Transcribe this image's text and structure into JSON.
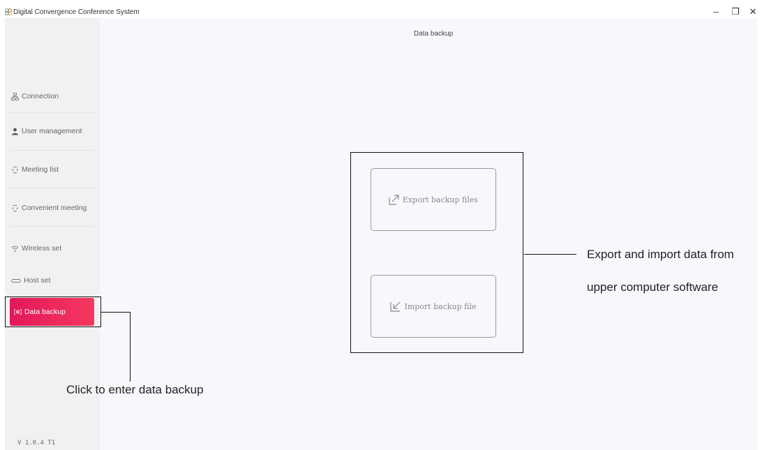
{
  "window": {
    "title": "Digital Convergence Conference System",
    "controls": {
      "minimize": "–",
      "maximize": "❐",
      "close": "✕"
    }
  },
  "sidebar": {
    "items": [
      {
        "label": "Connection",
        "icon": "network-icon"
      },
      {
        "label": "User management",
        "icon": "user-icon"
      },
      {
        "label": "Meeting list",
        "icon": "meeting-icon"
      },
      {
        "label": "Convenient meeting",
        "icon": "meeting-icon"
      },
      {
        "label": "Wireless set",
        "icon": "wifi-icon"
      },
      {
        "label": "Host set",
        "icon": "host-icon"
      }
    ],
    "active_item": {
      "label": "Data backup",
      "icon": "backup-icon"
    },
    "version": "V 1.0.4 T1"
  },
  "main": {
    "page_title": "Data backup",
    "export_button": {
      "label": "Export backup files",
      "icon": "export-icon"
    },
    "import_button": {
      "label": "Import backup file",
      "icon": "import-icon"
    }
  },
  "annotations": {
    "right_line1": "Export and import data from",
    "right_line2": "upper computer software",
    "bottom": "Click to enter data backup"
  },
  "colors": {
    "accent": "#e91e5a",
    "sidebar_bg": "#f1f1f1",
    "main_bg": "#f7f8fb"
  }
}
